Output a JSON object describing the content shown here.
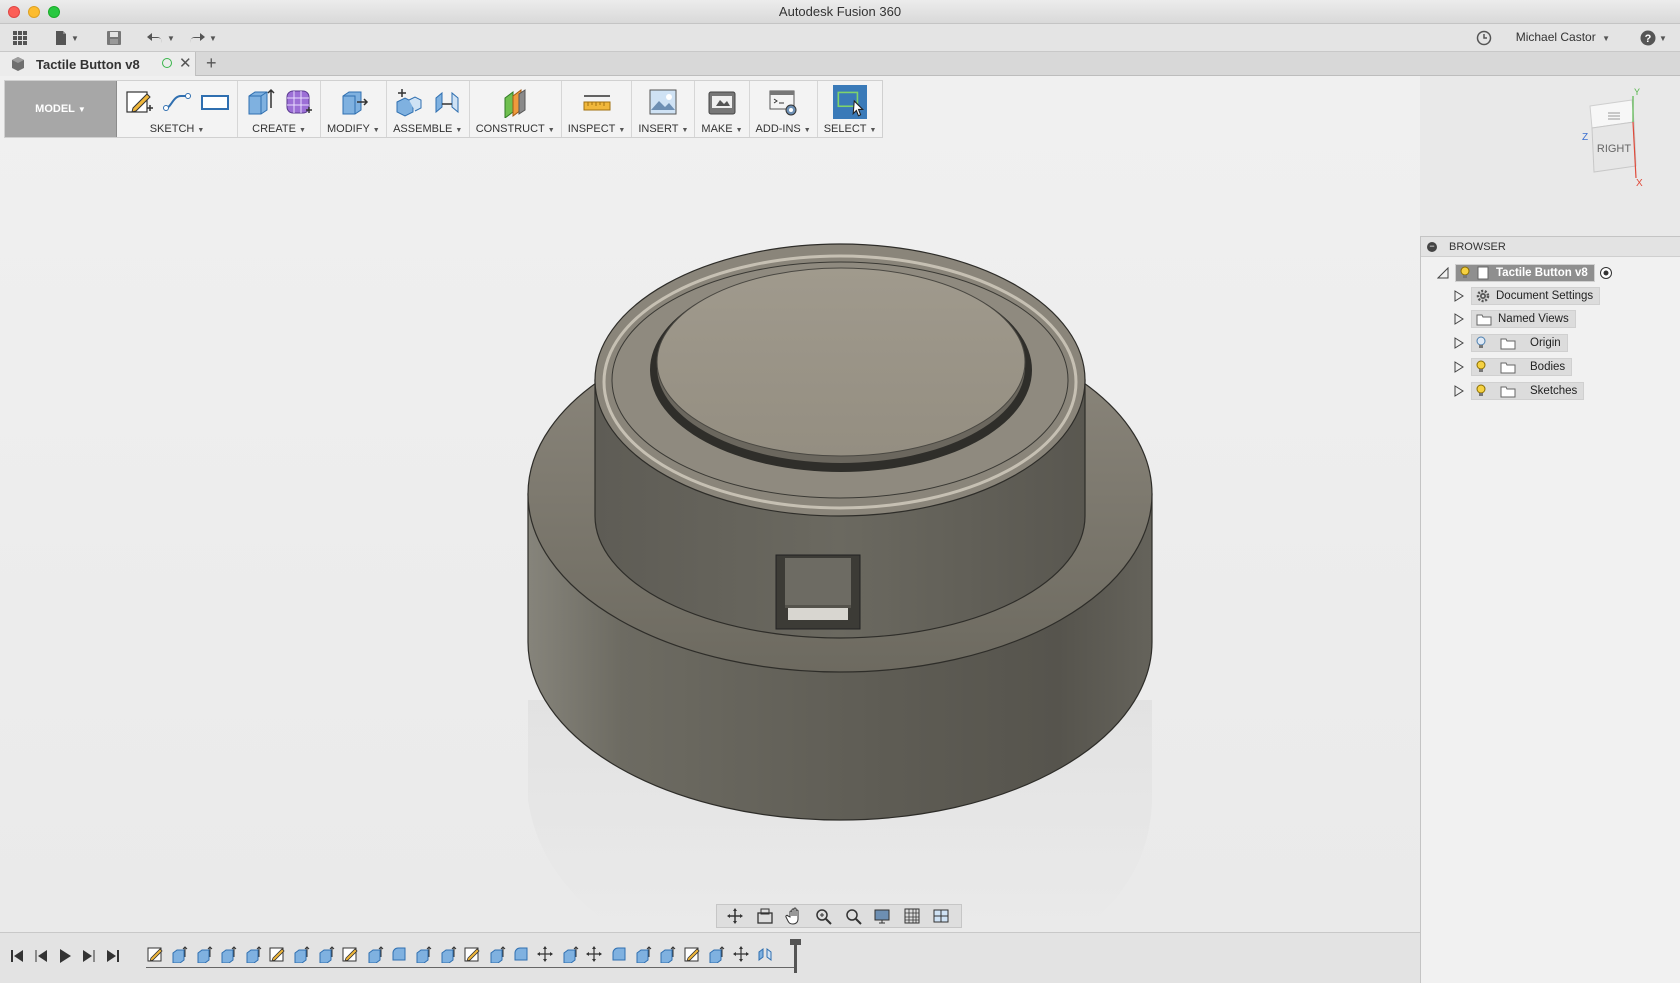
{
  "window": {
    "title": "Autodesk Fusion 360"
  },
  "appbar": {
    "user": "Michael Castor"
  },
  "document": {
    "tab_title": "Tactile Button v8"
  },
  "toolbar": {
    "workspace": "MODEL",
    "groups": [
      "SKETCH",
      "CREATE",
      "MODIFY",
      "ASSEMBLE",
      "CONSTRUCT",
      "INSPECT",
      "INSERT",
      "MAKE",
      "ADD-INS",
      "SELECT"
    ]
  },
  "viewcube": {
    "face": "RIGHT",
    "axes": [
      "Y",
      "Z",
      "X"
    ]
  },
  "browser": {
    "title": "BROWSER",
    "root": "Tactile Button v8",
    "items": [
      "Document Settings",
      "Named Views",
      "Origin",
      "Bodies",
      "Sketches"
    ]
  },
  "colors": {
    "accent": "#4a7fb0",
    "body": "#7a766c",
    "selection": "#3a7ab8"
  },
  "icons": {
    "navbar": [
      "orbit-icon",
      "look-at-icon",
      "pan-icon",
      "zoom-icon",
      "zoom-window-icon",
      "display-settings-icon",
      "grid-icon",
      "viewports-icon"
    ],
    "timeline": [
      "first-step-icon",
      "previous-step-icon",
      "play-icon",
      "next-step-icon",
      "last-step-icon"
    ]
  }
}
